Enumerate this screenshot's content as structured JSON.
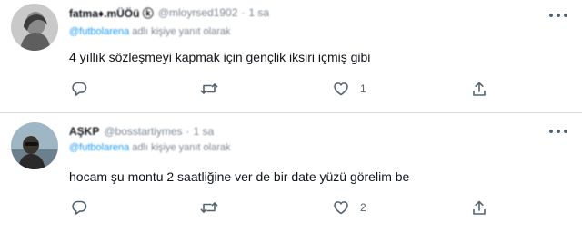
{
  "tweets": [
    {
      "display_name": "fatma♦.mÜÖü ⓚ",
      "handle": "@mloyrsed1902",
      "time": "1 sa",
      "reply_prefix": "@futbolarena",
      "reply_suffix": "adlı kişiye yanıt olarak",
      "text": "4 yıllık sözleşmeyi kapmak için gençlik iksiri içmiş gibi",
      "reply_count": "",
      "retweet_count": "",
      "like_count": "1"
    },
    {
      "display_name": "AŞKP",
      "handle": "@bosstartiymes",
      "time": "1 sa",
      "reply_prefix": "@futbolarena",
      "reply_suffix": "adlı kişiye yanıt olarak",
      "text": "hocam şu montu 2 saatliğine ver de bir date yüzü görelim be",
      "reply_count": "",
      "retweet_count": "",
      "like_count": "2"
    }
  ],
  "icons": {
    "reply": "reply-icon",
    "retweet": "retweet-icon",
    "like": "heart-icon",
    "share": "share-icon",
    "more": "more-options-icon"
  },
  "colors": {
    "text": "#0f1419",
    "muted": "#536471",
    "link": "#1d9bf0",
    "divider": "#d7dde2"
  }
}
